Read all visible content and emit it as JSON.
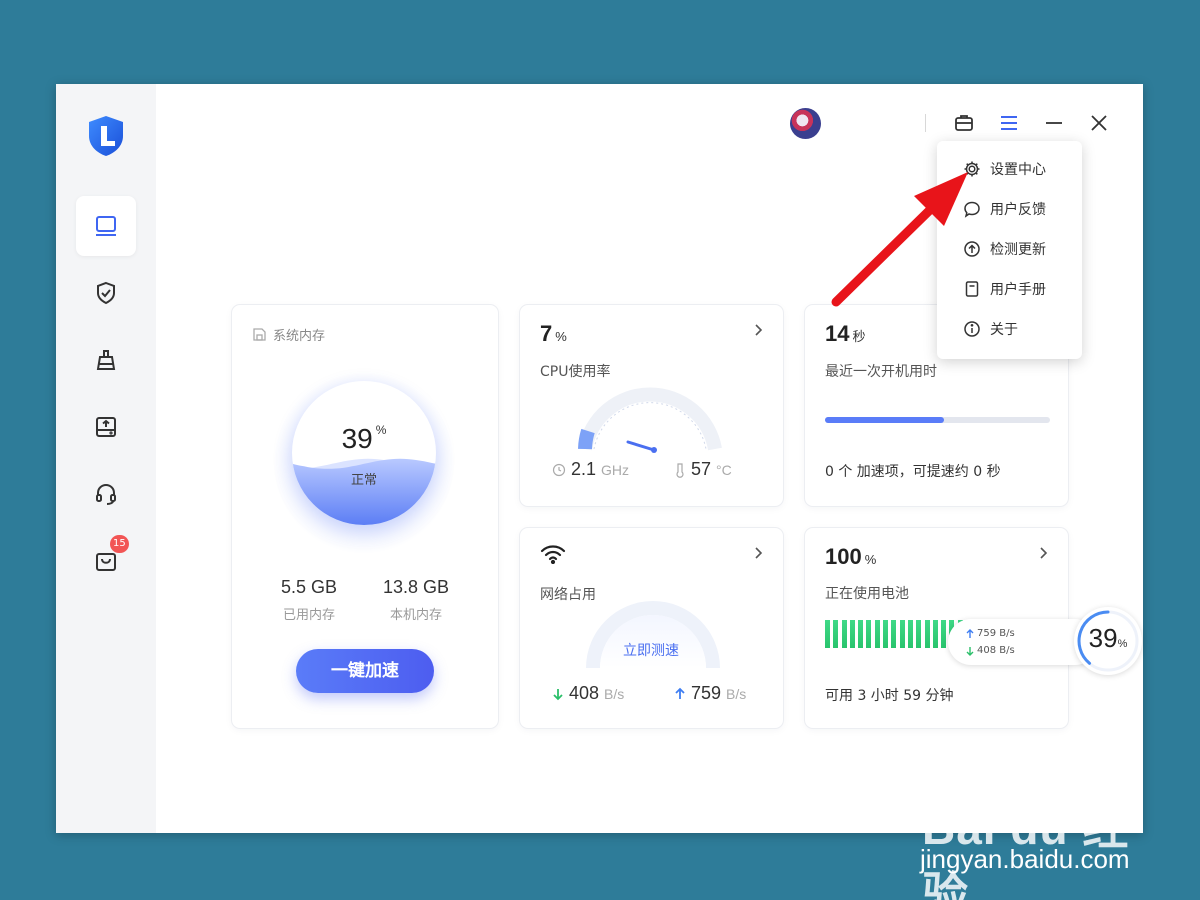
{
  "sidebar": {
    "items": [
      {
        "icon": "monitor-icon",
        "active": true
      },
      {
        "icon": "shield-check-icon",
        "active": false
      },
      {
        "icon": "broom-icon",
        "active": false
      },
      {
        "icon": "drive-upload-icon",
        "active": false
      },
      {
        "icon": "headset-icon",
        "active": false
      },
      {
        "icon": "bag-icon",
        "active": false,
        "badge": "15"
      }
    ]
  },
  "toolbar": {
    "icons": [
      "avatar",
      "toolbox-icon",
      "menu-icon",
      "minimize-icon",
      "close-icon"
    ]
  },
  "menu": {
    "items": [
      {
        "label": "设置中心",
        "icon": "gear-icon"
      },
      {
        "label": "用户反馈",
        "icon": "chat-bubble-icon"
      },
      {
        "label": "检测更新",
        "icon": "upload-circle-icon"
      },
      {
        "label": "用户手册",
        "icon": "book-icon"
      },
      {
        "label": "关于",
        "icon": "info-icon"
      }
    ]
  },
  "memory": {
    "title": "系统内存",
    "percent": "39",
    "unit": "%",
    "status": "正常",
    "level": 0.39,
    "used_value": "5.5 GB",
    "used_label": "已用内存",
    "total_value": "13.8 GB",
    "total_label": "本机内存",
    "boost_label": "一键加速"
  },
  "cpu": {
    "value": "7",
    "unit": "%",
    "label": "CPU使用率",
    "freq_value": "2.1",
    "freq_unit": "GHz",
    "temp_value": "57",
    "temp_unit": "°C"
  },
  "boot": {
    "value": "14",
    "unit": "秒",
    "label": "最近一次开机用时",
    "progress": 0.53,
    "summary": "0 个 加速项，可提速约 0 秒"
  },
  "network": {
    "label": "网络占用",
    "test_label": "立即测速",
    "down_value": "408",
    "down_unit": "B/s",
    "up_value": "759",
    "up_unit": "B/s"
  },
  "battery": {
    "value": "100",
    "unit": "%",
    "label": "正在使用电池",
    "remaining": "可用 3 小时 59 分钟",
    "level": 1.0
  },
  "widget": {
    "up": "759 B/s",
    "down": "408 B/s",
    "percent": "39",
    "unit": "%"
  },
  "watermark": {
    "brand": "Bai du 经验",
    "url": "jingyan.baidu.com"
  },
  "colors": {
    "accent": "#5a7cf8",
    "background": "#2e7c99",
    "battery": "#33d17a",
    "arrow": "#e8141a",
    "badge": "#f25555"
  }
}
